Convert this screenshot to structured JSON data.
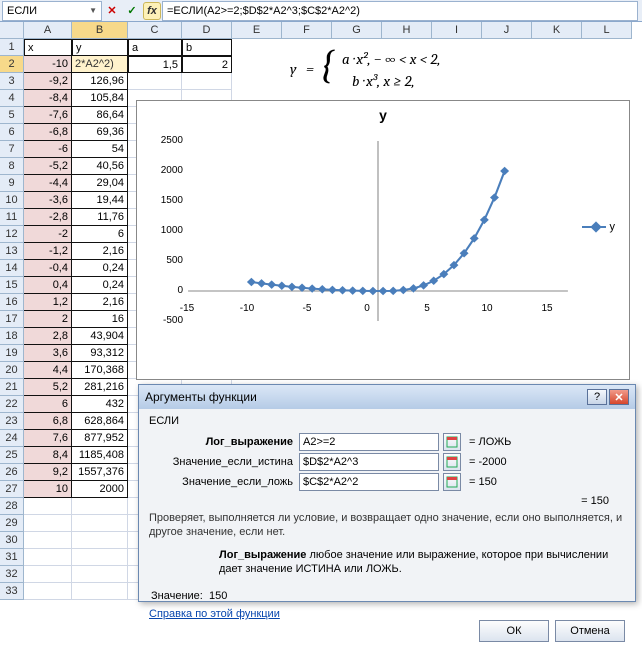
{
  "namebox": "ЕСЛИ",
  "formula": "=ЕСЛИ(A2>=2;$D$2*A2^3;$C$2*A2^2)",
  "columns": [
    "A",
    "B",
    "C",
    "D",
    "E",
    "F",
    "G",
    "H",
    "I",
    "J",
    "K",
    "L"
  ],
  "colwidths": {
    "A": 48,
    "B": 56,
    "C": 54,
    "D": 50,
    "E": 50,
    "F": 50,
    "G": 50,
    "H": 50,
    "I": 50,
    "J": 50,
    "K": 50,
    "L": 50
  },
  "headerRow": {
    "A": "x",
    "B": "y",
    "C": "a",
    "D": "b"
  },
  "paramRow": {
    "C": "1,5",
    "D": "2"
  },
  "activeCellDisplay": "2*A2^2)",
  "tableXY": [
    {
      "x": "-10",
      "y": ""
    },
    {
      "x": "-9,2",
      "y": "126,96"
    },
    {
      "x": "-8,4",
      "y": "105,84"
    },
    {
      "x": "-7,6",
      "y": "86,64"
    },
    {
      "x": "-6,8",
      "y": "69,36"
    },
    {
      "x": "-6",
      "y": "54"
    },
    {
      "x": "-5,2",
      "y": "40,56"
    },
    {
      "x": "-4,4",
      "y": "29,04"
    },
    {
      "x": "-3,6",
      "y": "19,44"
    },
    {
      "x": "-2,8",
      "y": "11,76"
    },
    {
      "x": "-2",
      "y": "6"
    },
    {
      "x": "-1,2",
      "y": "2,16"
    },
    {
      "x": "-0,4",
      "y": "0,24"
    },
    {
      "x": "0,4",
      "y": "0,24"
    },
    {
      "x": "1,2",
      "y": "2,16"
    },
    {
      "x": "2",
      "y": "16"
    },
    {
      "x": "2,8",
      "y": "43,904"
    },
    {
      "x": "3,6",
      "y": "93,312"
    },
    {
      "x": "4,4",
      "y": "170,368"
    },
    {
      "x": "5,2",
      "y": "281,216"
    },
    {
      "x": "6",
      "y": "432"
    },
    {
      "x": "6,8",
      "y": "628,864"
    },
    {
      "x": "7,6",
      "y": "877,952"
    },
    {
      "x": "8,4",
      "y": "1185,408"
    },
    {
      "x": "9,2",
      "y": "1557,376"
    },
    {
      "x": "10",
      "y": "2000"
    }
  ],
  "equation": {
    "y": "y",
    "line1": "a · x²,   − ∞ < x < 2,",
    "line2": "b · x³,    x ≥ 2,"
  },
  "chart_data": {
    "type": "line",
    "title": "y",
    "xlabel": "",
    "ylabel": "",
    "xlim": [
      -15,
      15
    ],
    "ylim": [
      -500,
      2500
    ],
    "xticks": [
      -15,
      -10,
      -5,
      0,
      5,
      10,
      15
    ],
    "yticks": [
      -500,
      0,
      500,
      1000,
      1500,
      2000,
      2500
    ],
    "series": [
      {
        "name": "y",
        "x": [
          -10,
          -9.2,
          -8.4,
          -7.6,
          -6.8,
          -6,
          -5.2,
          -4.4,
          -3.6,
          -2.8,
          -2,
          -1.2,
          -0.4,
          0.4,
          1.2,
          2,
          2.8,
          3.6,
          4.4,
          5.2,
          6,
          6.8,
          7.6,
          8.4,
          9.2,
          10
        ],
        "y": [
          150,
          126.96,
          105.84,
          86.64,
          69.36,
          54,
          40.56,
          29.04,
          19.44,
          11.76,
          6,
          2.16,
          0.24,
          0.24,
          2.16,
          16,
          43.904,
          93.312,
          170.368,
          281.216,
          432,
          628.864,
          877.952,
          1185.408,
          1557.376,
          2000
        ]
      }
    ],
    "legend": {
      "position": "right"
    }
  },
  "dialog": {
    "title": "Аргументы функции",
    "funcName": "ЕСЛИ",
    "args": [
      {
        "label": "Лог_выражение",
        "bold": true,
        "value": "A2>=2",
        "result": "= ЛОЖЬ"
      },
      {
        "label": "Значение_если_истина",
        "bold": false,
        "value": "$D$2*A2^3",
        "result": "= -2000"
      },
      {
        "label": "Значение_если_ложь",
        "bold": false,
        "value": "$C$2*A2^2",
        "result": "= 150"
      }
    ],
    "totalResult": "= 150",
    "desc1": "Проверяет, выполняется ли условие, и возвращает одно значение, если оно выполняется, и другое значение, если нет.",
    "desc2label": "Лог_выражение",
    "desc2text": "любое значение или выражение, которое при вычислении дает значение ИСТИНА или ЛОЖЬ.",
    "valueLabel": "Значение:",
    "valueResult": "150",
    "helpLink": "Справка по этой функции",
    "ok": "ОК",
    "cancel": "Отмена"
  }
}
